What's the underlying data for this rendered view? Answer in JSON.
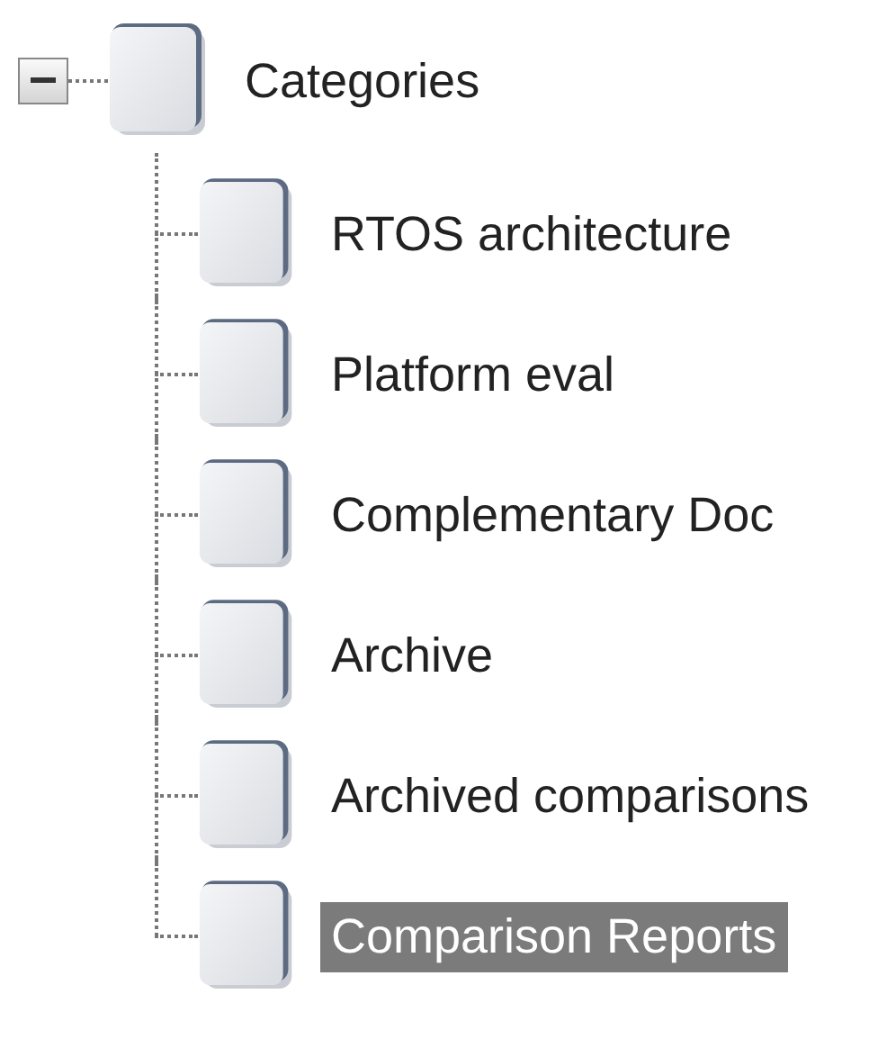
{
  "tree": {
    "label": "Categories",
    "expanded": true,
    "selected": false,
    "children": [
      {
        "label": "RTOS architecture",
        "selected": false
      },
      {
        "label": "Platform eval",
        "selected": false
      },
      {
        "label": "Complementary Doc",
        "selected": false
      },
      {
        "label": "Archive",
        "selected": false
      },
      {
        "label": "Archived comparisons",
        "selected": false
      },
      {
        "label": "Comparison Reports",
        "selected": true
      }
    ]
  }
}
